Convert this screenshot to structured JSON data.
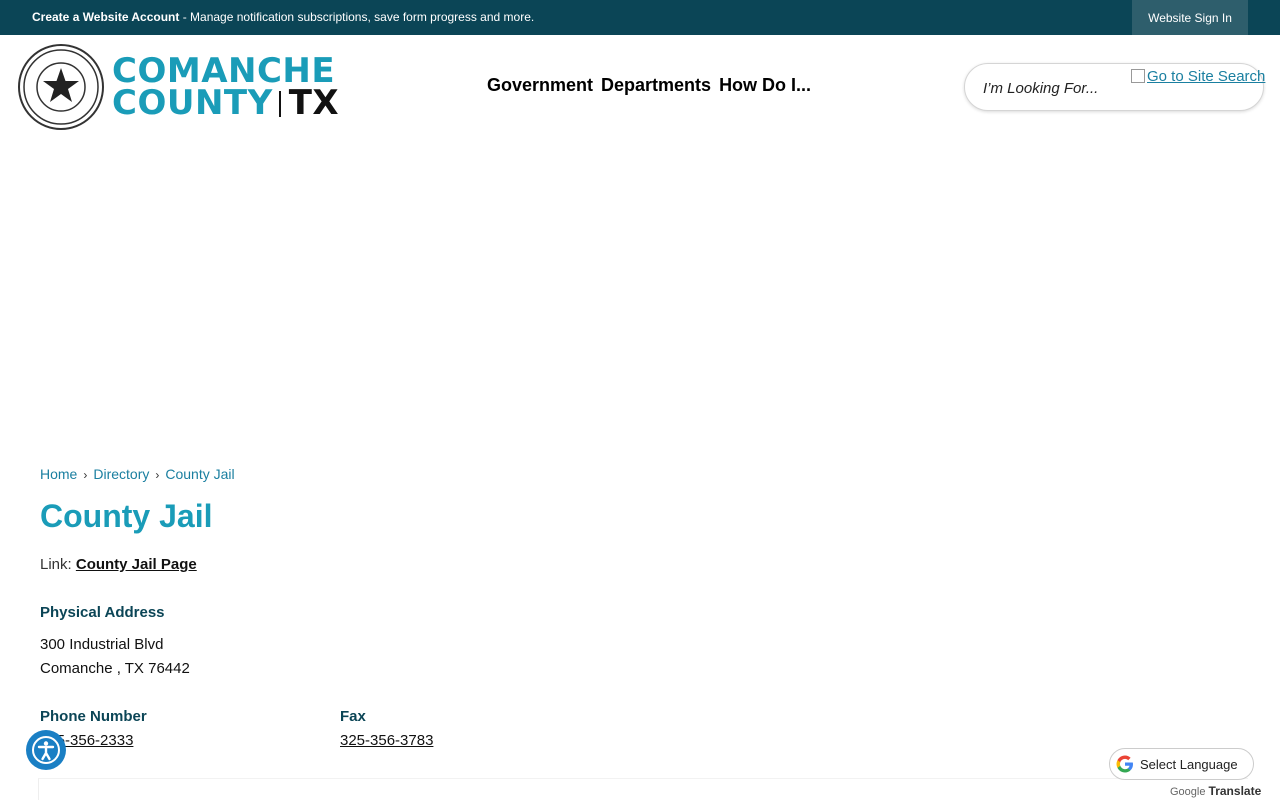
{
  "topbar": {
    "account_link": "Create a Website Account",
    "account_desc": " - Manage notification subscriptions, save form progress and more.",
    "signin": "Website Sign In",
    "bg_color": "#0b4556"
  },
  "header": {
    "logo_line1": "COMANCHE",
    "logo_line2": "COUNTY",
    "logo_suffix": "TX",
    "nav": [
      "Government",
      "Departments",
      "How Do I..."
    ],
    "search_placeholder": "I’m Looking For...",
    "search_go": "Go to Site Search"
  },
  "breadcrumb": [
    "Home",
    "Directory",
    "County Jail"
  ],
  "page": {
    "title": "County Jail",
    "link_label": "Link:",
    "link_text": "County Jail Page",
    "address_label": "Physical Address",
    "address_line1": "300 Industrial Blvd",
    "address_line2": "Comanche , TX 76442",
    "phone_label": "Phone Number",
    "phone": "325-356-2333",
    "fax_label": "Fax",
    "fax": "325-356-3783"
  },
  "translate": {
    "select": "Select Language",
    "powered_by": "Google",
    "translate": "Translate"
  },
  "colors": {
    "accent": "#1a9cb8",
    "dark": "#0b4556"
  },
  "icons": [
    "county-seal-icon",
    "accessibility-icon",
    "google-g-icon"
  ]
}
